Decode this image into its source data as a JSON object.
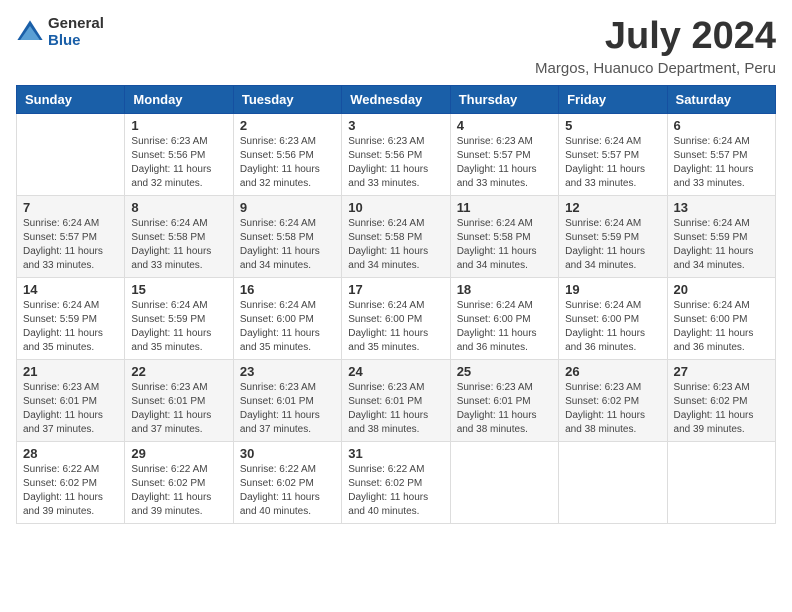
{
  "logo": {
    "general": "General",
    "blue": "Blue"
  },
  "title": {
    "month": "July 2024",
    "location": "Margos, Huanuco Department, Peru"
  },
  "weekdays": [
    "Sunday",
    "Monday",
    "Tuesday",
    "Wednesday",
    "Thursday",
    "Friday",
    "Saturday"
  ],
  "weeks": [
    [
      {
        "day": "",
        "info": ""
      },
      {
        "day": "1",
        "info": "Sunrise: 6:23 AM\nSunset: 5:56 PM\nDaylight: 11 hours and 32 minutes."
      },
      {
        "day": "2",
        "info": "Sunrise: 6:23 AM\nSunset: 5:56 PM\nDaylight: 11 hours and 32 minutes."
      },
      {
        "day": "3",
        "info": "Sunrise: 6:23 AM\nSunset: 5:56 PM\nDaylight: 11 hours and 33 minutes."
      },
      {
        "day": "4",
        "info": "Sunrise: 6:23 AM\nSunset: 5:57 PM\nDaylight: 11 hours and 33 minutes."
      },
      {
        "day": "5",
        "info": "Sunrise: 6:24 AM\nSunset: 5:57 PM\nDaylight: 11 hours and 33 minutes."
      },
      {
        "day": "6",
        "info": "Sunrise: 6:24 AM\nSunset: 5:57 PM\nDaylight: 11 hours and 33 minutes."
      }
    ],
    [
      {
        "day": "7",
        "info": "Sunrise: 6:24 AM\nSunset: 5:57 PM\nDaylight: 11 hours and 33 minutes."
      },
      {
        "day": "8",
        "info": "Sunrise: 6:24 AM\nSunset: 5:58 PM\nDaylight: 11 hours and 33 minutes."
      },
      {
        "day": "9",
        "info": "Sunrise: 6:24 AM\nSunset: 5:58 PM\nDaylight: 11 hours and 34 minutes."
      },
      {
        "day": "10",
        "info": "Sunrise: 6:24 AM\nSunset: 5:58 PM\nDaylight: 11 hours and 34 minutes."
      },
      {
        "day": "11",
        "info": "Sunrise: 6:24 AM\nSunset: 5:58 PM\nDaylight: 11 hours and 34 minutes."
      },
      {
        "day": "12",
        "info": "Sunrise: 6:24 AM\nSunset: 5:59 PM\nDaylight: 11 hours and 34 minutes."
      },
      {
        "day": "13",
        "info": "Sunrise: 6:24 AM\nSunset: 5:59 PM\nDaylight: 11 hours and 34 minutes."
      }
    ],
    [
      {
        "day": "14",
        "info": "Sunrise: 6:24 AM\nSunset: 5:59 PM\nDaylight: 11 hours and 35 minutes."
      },
      {
        "day": "15",
        "info": "Sunrise: 6:24 AM\nSunset: 5:59 PM\nDaylight: 11 hours and 35 minutes."
      },
      {
        "day": "16",
        "info": "Sunrise: 6:24 AM\nSunset: 6:00 PM\nDaylight: 11 hours and 35 minutes."
      },
      {
        "day": "17",
        "info": "Sunrise: 6:24 AM\nSunset: 6:00 PM\nDaylight: 11 hours and 35 minutes."
      },
      {
        "day": "18",
        "info": "Sunrise: 6:24 AM\nSunset: 6:00 PM\nDaylight: 11 hours and 36 minutes."
      },
      {
        "day": "19",
        "info": "Sunrise: 6:24 AM\nSunset: 6:00 PM\nDaylight: 11 hours and 36 minutes."
      },
      {
        "day": "20",
        "info": "Sunrise: 6:24 AM\nSunset: 6:00 PM\nDaylight: 11 hours and 36 minutes."
      }
    ],
    [
      {
        "day": "21",
        "info": "Sunrise: 6:23 AM\nSunset: 6:01 PM\nDaylight: 11 hours and 37 minutes."
      },
      {
        "day": "22",
        "info": "Sunrise: 6:23 AM\nSunset: 6:01 PM\nDaylight: 11 hours and 37 minutes."
      },
      {
        "day": "23",
        "info": "Sunrise: 6:23 AM\nSunset: 6:01 PM\nDaylight: 11 hours and 37 minutes."
      },
      {
        "day": "24",
        "info": "Sunrise: 6:23 AM\nSunset: 6:01 PM\nDaylight: 11 hours and 38 minutes."
      },
      {
        "day": "25",
        "info": "Sunrise: 6:23 AM\nSunset: 6:01 PM\nDaylight: 11 hours and 38 minutes."
      },
      {
        "day": "26",
        "info": "Sunrise: 6:23 AM\nSunset: 6:02 PM\nDaylight: 11 hours and 38 minutes."
      },
      {
        "day": "27",
        "info": "Sunrise: 6:23 AM\nSunset: 6:02 PM\nDaylight: 11 hours and 39 minutes."
      }
    ],
    [
      {
        "day": "28",
        "info": "Sunrise: 6:22 AM\nSunset: 6:02 PM\nDaylight: 11 hours and 39 minutes."
      },
      {
        "day": "29",
        "info": "Sunrise: 6:22 AM\nSunset: 6:02 PM\nDaylight: 11 hours and 39 minutes."
      },
      {
        "day": "30",
        "info": "Sunrise: 6:22 AM\nSunset: 6:02 PM\nDaylight: 11 hours and 40 minutes."
      },
      {
        "day": "31",
        "info": "Sunrise: 6:22 AM\nSunset: 6:02 PM\nDaylight: 11 hours and 40 minutes."
      },
      {
        "day": "",
        "info": ""
      },
      {
        "day": "",
        "info": ""
      },
      {
        "day": "",
        "info": ""
      }
    ]
  ]
}
